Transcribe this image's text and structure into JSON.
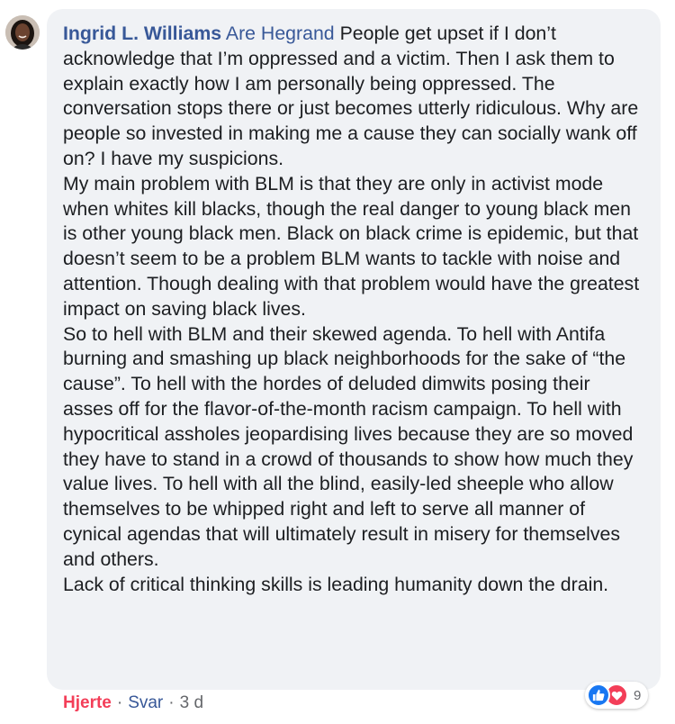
{
  "comment": {
    "author": "Ingrid L. Williams",
    "mention": "Are Hegrand",
    "paragraphs": [
      "People get upset if I don’t acknowledge that I’m oppressed and a victim. Then I ask them to explain exactly how I am personally being oppressed. The conversation stops there or just becomes utterly ridiculous. Why are people so invested in making me a cause they can socially wank off on? I have my suspicions.",
      "My main problem with BLM is that they are only in activist mode when whites kill blacks, though the real danger to young black men is other young black men. Black on black crime is epidemic, but that doesn’t seem to be a problem BLM wants to tackle with noise and attention. Though dealing with that problem would have the greatest impact on saving black lives.",
      "So to hell with BLM and their skewed agenda. To hell with Antifa burning and smashing up black neighborhoods for the sake of “the cause”. To hell with the hordes of deluded dimwits posing their asses off for the flavor-of-the-month racism campaign. To hell with hypocritical assholes jeopardising lives because they are so moved they have to stand in a crowd of thousands to show how much they value lives. To hell with all the blind, easily-led sheeple who allow themselves to be whipped right and left to serve all manner of cynical agendas that will ultimately result in misery for themselves and others.",
      "Lack of critical thinking skills is leading humanity down the drain."
    ]
  },
  "reactions": {
    "icons": [
      "like-icon",
      "love-icon"
    ],
    "count": "9",
    "like_color": "#1877f2",
    "love_color": "#f33e58"
  },
  "actions": {
    "like_label": "Hjerte",
    "reply_label": "Svar",
    "separator": "·",
    "time": "3 d"
  }
}
